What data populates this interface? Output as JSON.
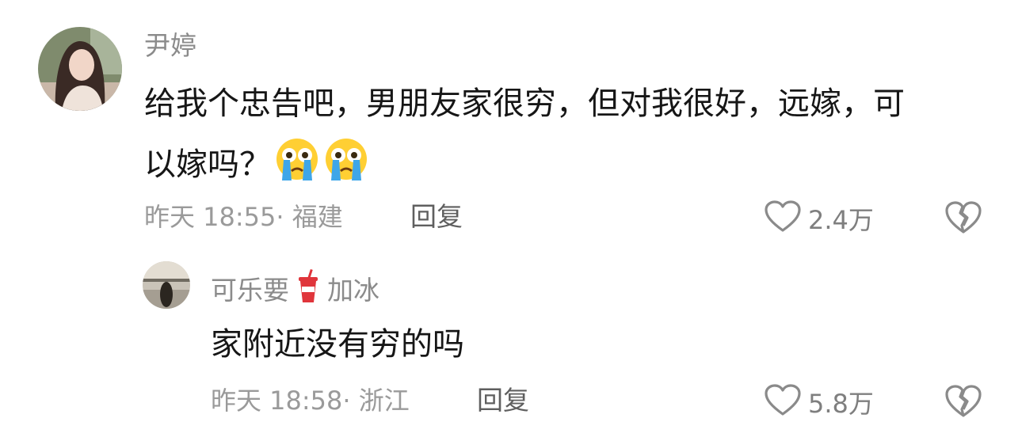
{
  "comments": [
    {
      "username": "尹婷",
      "content_line1": "给我个忠告吧，男朋友家很穷，但对我很好，远嫁，可",
      "content_line2": "以嫁吗？",
      "emojis": [
        "crying-face-emoji",
        "crying-face-emoji"
      ],
      "meta": "昨天 18:55· 福建",
      "reply_label": "回复",
      "likes": "2.4万"
    }
  ],
  "replies": [
    {
      "username_prefix": "可乐要",
      "username_icon": "soda-cup-icon",
      "username_suffix": "加冰",
      "content": "家附近没有穷的吗",
      "meta": "昨天 18:58· 浙江",
      "reply_label": "回复",
      "likes": "5.8万"
    }
  ],
  "colors": {
    "text": "#161616",
    "muted": "#9a9a9a",
    "username": "#8b8b8b",
    "cup_red": "#e0353b"
  }
}
